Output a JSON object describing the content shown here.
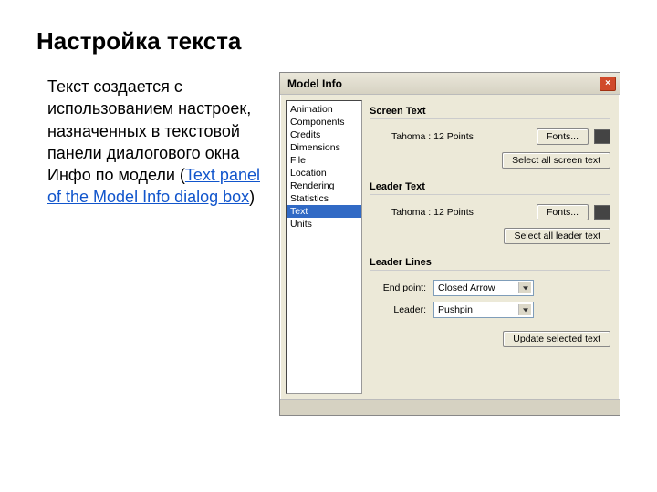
{
  "slide": {
    "title": "Настройка текста",
    "body_prefix": "Текст  создается с использованием настроек, назначенных в текстовой панели диалогового окна Инфо по модели (",
    "link_text": "Text panel of the Model Info dialog box",
    "body_suffix": ")"
  },
  "dialog": {
    "title": "Model Info",
    "close_label": "×",
    "sidebar": {
      "items": [
        {
          "label": "Animation"
        },
        {
          "label": "Components"
        },
        {
          "label": "Credits"
        },
        {
          "label": "Dimensions"
        },
        {
          "label": "File"
        },
        {
          "label": "Location"
        },
        {
          "label": "Rendering"
        },
        {
          "label": "Statistics"
        },
        {
          "label": "Text",
          "selected": true
        },
        {
          "label": "Units"
        }
      ]
    },
    "sections": {
      "screen_text": {
        "heading": "Screen Text",
        "font_desc": "Tahoma : 12 Points",
        "fonts_btn": "Fonts...",
        "select_all_btn": "Select all screen text"
      },
      "leader_text": {
        "heading": "Leader Text",
        "font_desc": "Tahoma : 12 Points",
        "fonts_btn": "Fonts...",
        "select_all_btn": "Select all leader text"
      },
      "leader_lines": {
        "heading": "Leader Lines",
        "endpoint_label": "End point:",
        "endpoint_value": "Closed Arrow",
        "leader_label": "Leader:",
        "leader_value": "Pushpin",
        "update_btn": "Update selected text"
      }
    }
  },
  "colors": {
    "swatch": "#3d3d3d"
  }
}
